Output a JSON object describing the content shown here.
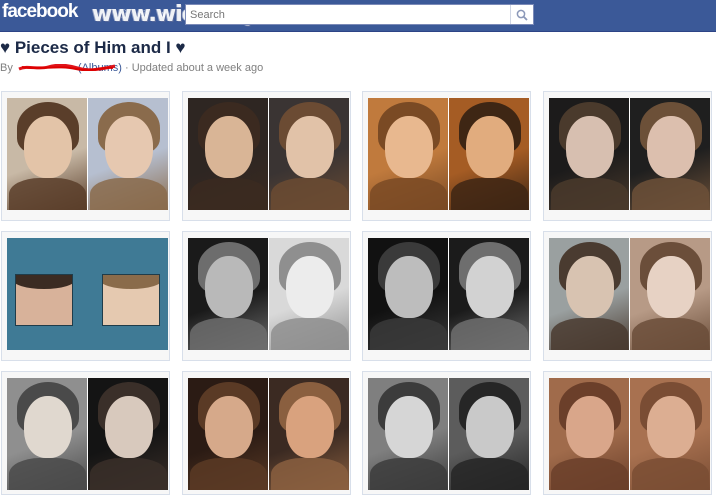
{
  "topbar": {
    "logo": "facebook",
    "watermark": "www.wiocha.pl",
    "search_placeholder": "Search",
    "icons": [
      "friend-requests-icon",
      "messages-icon",
      "notifications-icon"
    ],
    "color": "#3b5998"
  },
  "album": {
    "title": "♥ Pieces of Him and I ♥",
    "by": "By",
    "albums_link": "(Albums)",
    "updated": " · Updated about a week ago"
  },
  "photos": [
    {
      "id": "photo-1",
      "left": [
        "#c8b9a6",
        "#5a3e2a",
        "#e3c4a8"
      ],
      "right": [
        "#b6bfd0",
        "#8a6b4c",
        "#e6c8b0"
      ]
    },
    {
      "id": "photo-2",
      "left": [
        "#2e2622",
        "#3b2a20",
        "#d9b596"
      ],
      "right": [
        "#3a3433",
        "#6b4b33",
        "#e1c2a8"
      ]
    },
    {
      "id": "photo-3",
      "left": [
        "#c07a3d",
        "#7a4a24",
        "#e8b88f"
      ],
      "right": [
        "#a55c24",
        "#3e2614",
        "#e1ac7e"
      ]
    },
    {
      "id": "photo-4",
      "left": [
        "#1c1b1b",
        "#4a3a2c",
        "#d7bfb0"
      ],
      "right": [
        "#1f1f1f",
        "#6c5038",
        "#dcbfae"
      ]
    },
    {
      "id": "photo-5",
      "left": [
        "#3f7a95",
        "#3b2b22",
        "#d8b29a"
      ],
      "right": [
        "#3f7a95",
        "#8a6b4a",
        "#e5c9b0"
      ],
      "blue": true
    },
    {
      "id": "photo-6",
      "left": [
        "#1a1a1a",
        "#6d6d6d",
        "#b9b9b9"
      ],
      "right": [
        "#d9d9d9",
        "#8f8f8f",
        "#ececec"
      ]
    },
    {
      "id": "photo-7",
      "left": [
        "#111111",
        "#3a3a3a",
        "#bdbdbd"
      ],
      "right": [
        "#1b1b1b",
        "#6e6e6e",
        "#d2d2d2"
      ]
    },
    {
      "id": "photo-8",
      "left": [
        "#9aa0a0",
        "#4a3b30",
        "#d8c3b1"
      ],
      "right": [
        "#b79a86",
        "#6b4e3a",
        "#e7d2c4"
      ]
    },
    {
      "id": "photo-9",
      "left": [
        "#8f8f8f",
        "#4a4a4a",
        "#e0d8cf"
      ],
      "right": [
        "#141414",
        "#3a2f29",
        "#d8c9bd"
      ]
    },
    {
      "id": "photo-10",
      "left": [
        "#2b1b14",
        "#5a3a25",
        "#d6a98a"
      ],
      "right": [
        "#3b2a22",
        "#8a5f3f",
        "#d9a27e"
      ]
    },
    {
      "id": "photo-11",
      "left": [
        "#7f7f7f",
        "#3c3c3c",
        "#d6d6d6"
      ],
      "right": [
        "#5c5c5c",
        "#262626",
        "#c9c9c9"
      ]
    },
    {
      "id": "photo-12",
      "left": [
        "#a06b4b",
        "#6b3f2a",
        "#d9a68a"
      ],
      "right": [
        "#a87150",
        "#7a4d34",
        "#dcae92"
      ]
    }
  ]
}
